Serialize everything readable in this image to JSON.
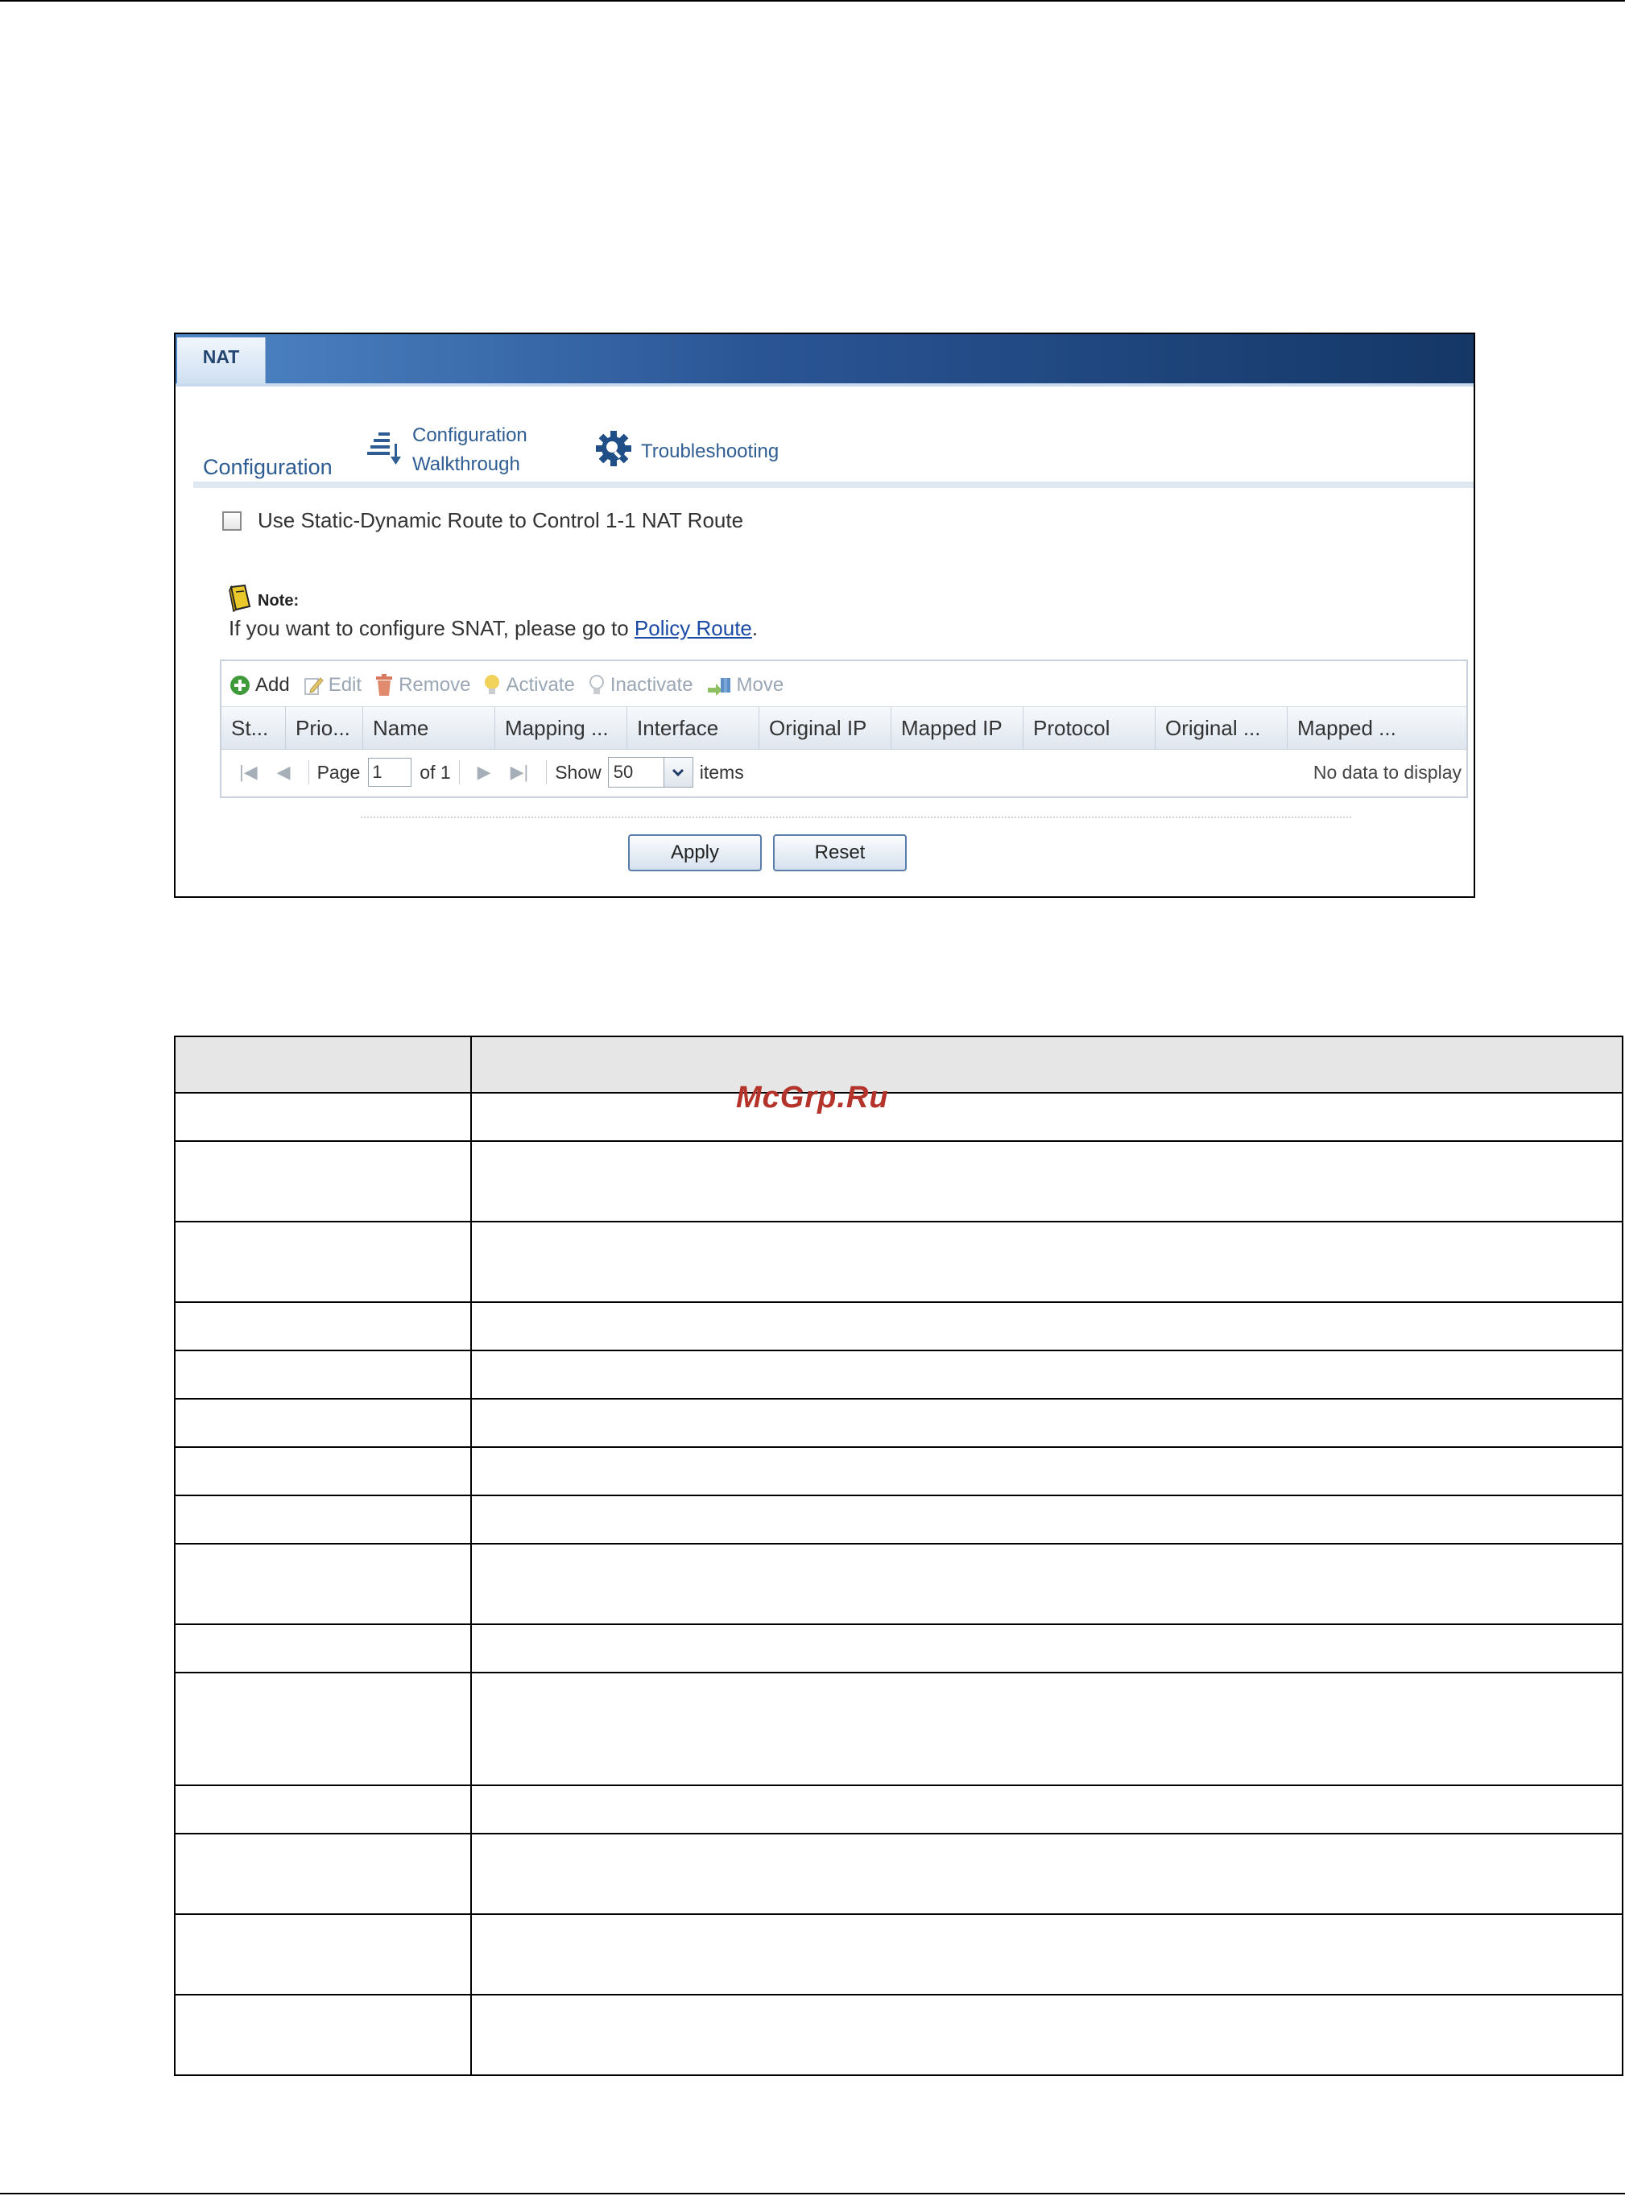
{
  "tab": {
    "label": "NAT"
  },
  "section": {
    "title": "Configuration",
    "walkthrough_line1": "Configuration",
    "walkthrough_line2": "Walkthrough",
    "troubleshooting": "Troubleshooting"
  },
  "option": {
    "static_route_label": "Use Static-Dynamic Route to Control 1-1 NAT Route",
    "checked": false
  },
  "note": {
    "heading": "Note:",
    "text_before": "If you want to configure SNAT, please go to ",
    "link": "Policy Route",
    "text_after": "."
  },
  "toolbar": {
    "add": "Add",
    "edit": "Edit",
    "remove": "Remove",
    "activate": "Activate",
    "inactivate": "Inactivate",
    "move": "Move"
  },
  "columns": [
    "St...",
    "Prio...",
    "Name",
    "Mapping ...",
    "Interface",
    "Original IP",
    "Mapped IP",
    "Protocol",
    "Original ...",
    "Mapped ..."
  ],
  "pager": {
    "page_label": "Page",
    "page_value": "1",
    "of_label": "of 1",
    "show_label": "Show",
    "show_value": "50",
    "items_label": "items",
    "no_data": "No data to display"
  },
  "buttons": {
    "apply": "Apply",
    "reset": "Reset"
  },
  "watermark": "McGrp.Ru",
  "colors": {
    "tab_gradient_start": "#4f86c6",
    "tab_gradient_end": "#143766",
    "link": "#1a4aa6",
    "watermark": "#b4342b"
  }
}
